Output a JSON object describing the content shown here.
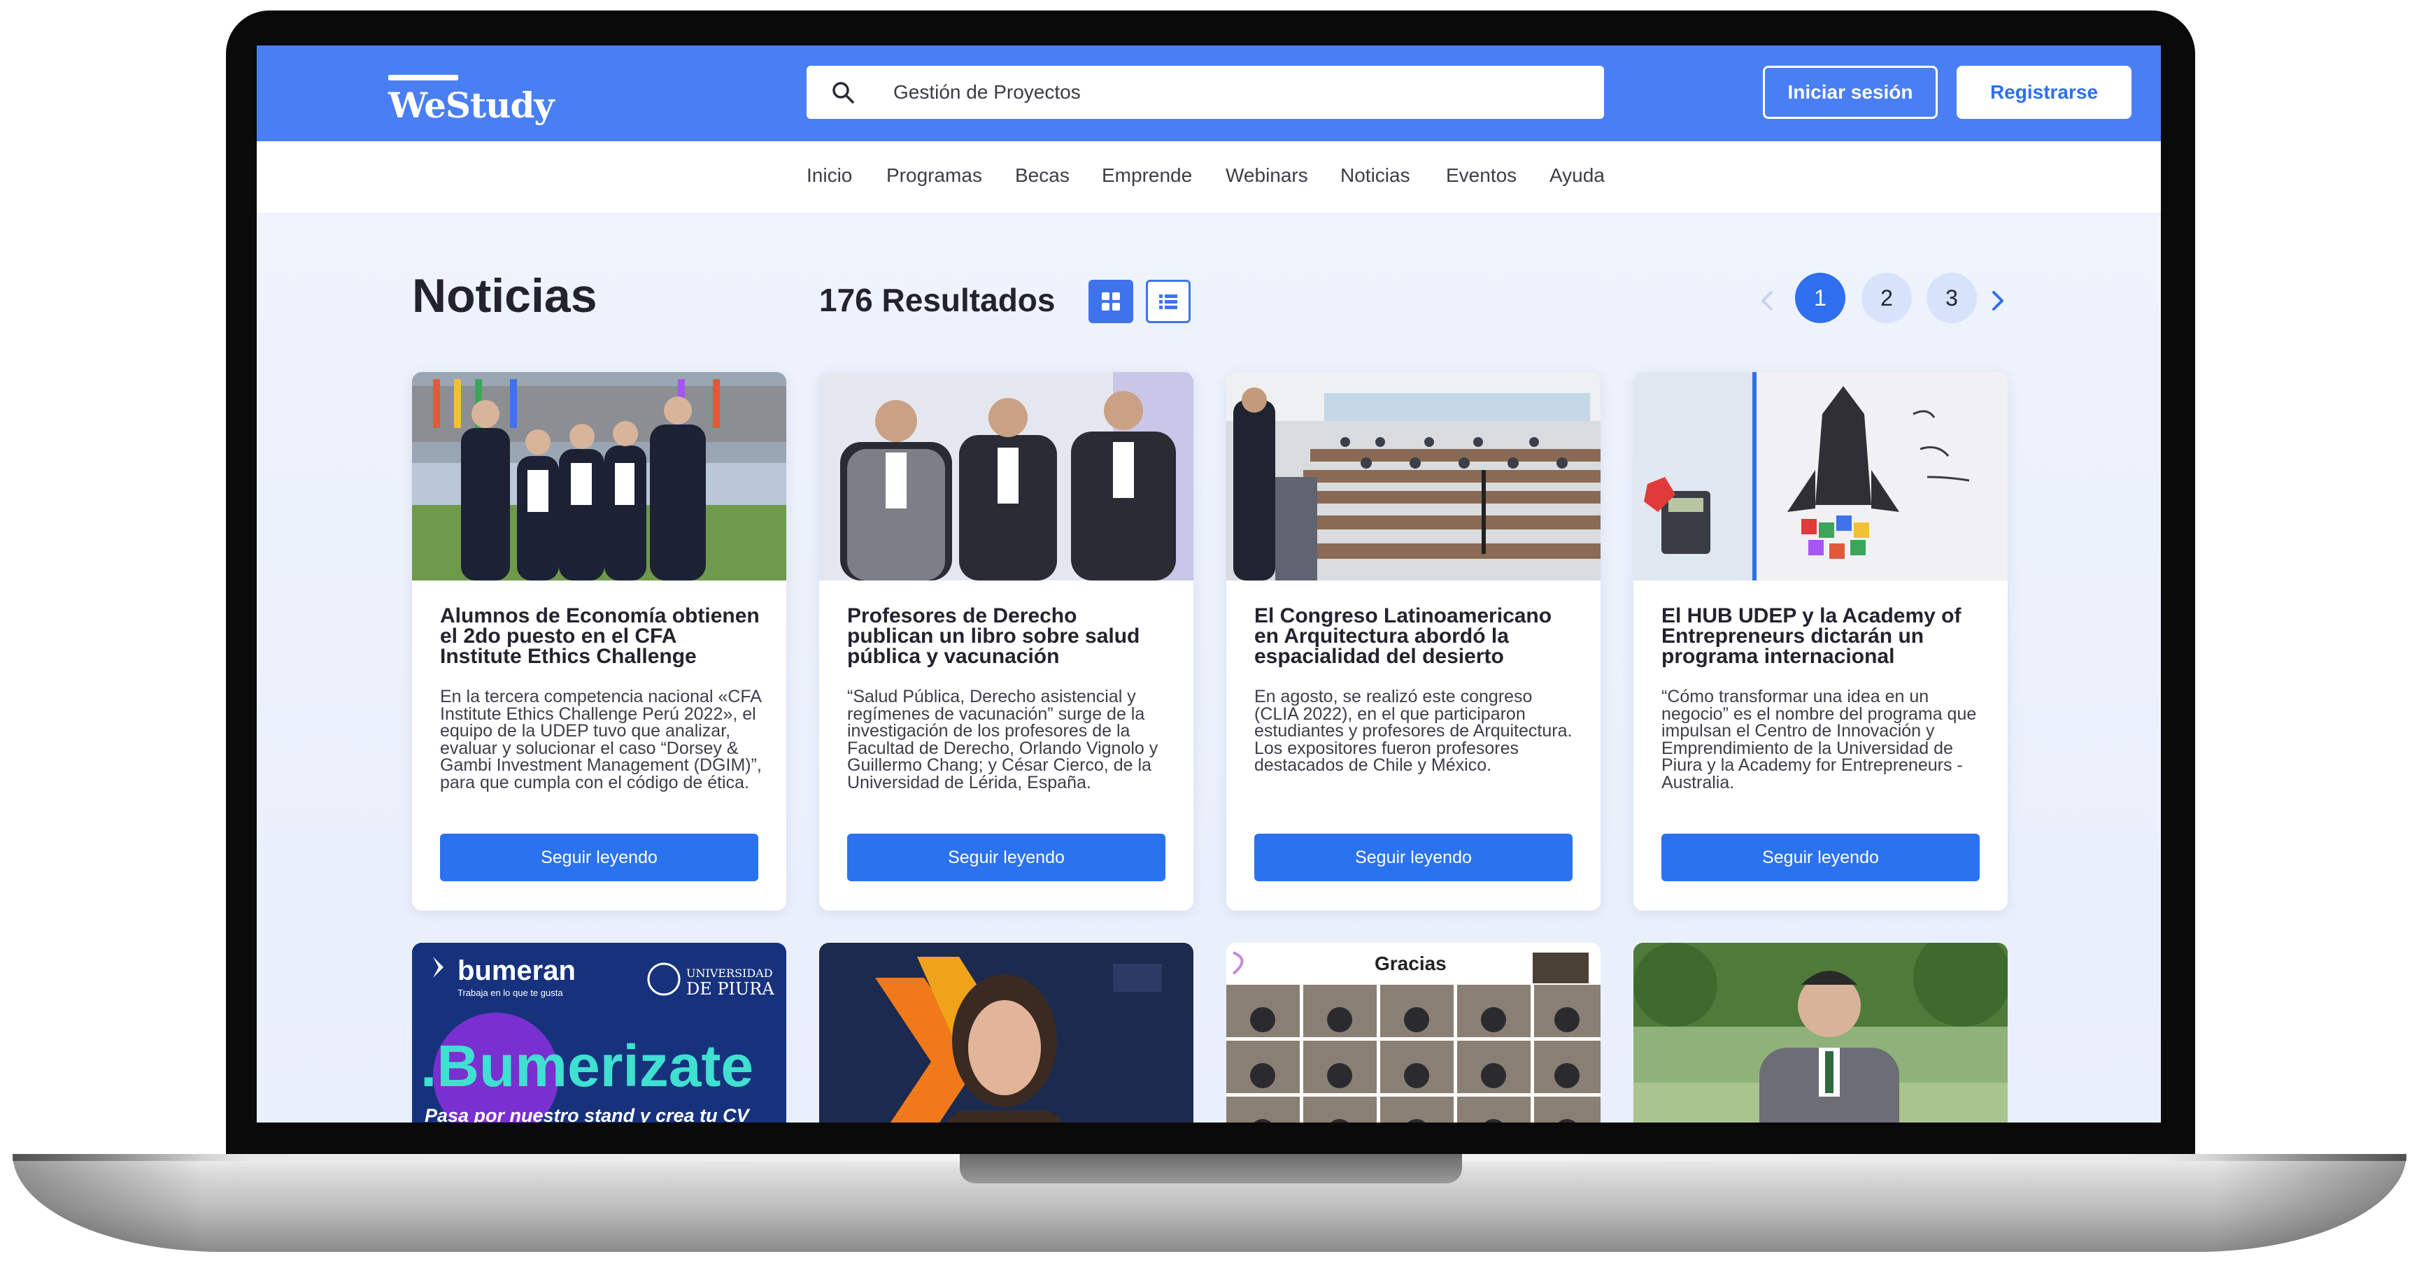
{
  "header": {
    "logo_text": "WeStudy",
    "search_value": "Gestión de Proyectos",
    "login_label": "Iniciar sesión",
    "register_label": "Registrarse"
  },
  "nav": [
    "Inicio",
    "Programas",
    "Becas",
    "Emprende",
    "Webinars",
    "Noticias",
    "Eventos",
    "Ayuda"
  ],
  "main": {
    "title": "Noticias",
    "results": "176 Resultados",
    "pages": [
      "1",
      "2",
      "3"
    ]
  },
  "cards": [
    {
      "title": "Alumnos de Economía obtienen el 2do puesto en el CFA Institute Ethics Challenge",
      "text": "En la tercera competencia nacional «CFA Institute Ethics Challenge Perú 2022», el equipo de la UDEP tuvo que analizar, evaluar y solucionar el caso “Dorsey & Gambi Investment Management (DGIM)”, para que cumpla con el código de ética.",
      "cta": "Seguir leyendo"
    },
    {
      "title": "Profesores de Derecho publican un libro sobre salud pública y vacunación",
      "text": "“Salud Pública, Derecho asistencial y regímenes de vacunación” surge de la investigación de los profesores de la Facultad de Derecho, Orlando Vignolo y Guillermo Chang; y César Cierco, de la Universidad de Lérida, España.",
      "cta": "Seguir leyendo"
    },
    {
      "title": "El Congreso Latinoamericano en Arquitectura abordó la espacialidad del desierto",
      "text": "En agosto, se realizó este congreso (CLIA 2022), en el que participaron estudiantes y profesores de Arquitectura. Los expositores fueron profesores destacados de Chile y México.",
      "cta": "Seguir leyendo"
    },
    {
      "title": "El HUB UDEP y la Academy of Entrepreneurs dictarán un programa internacional",
      "text": "“Cómo transformar una idea en un negocio” es el nombre del programa que impulsan el Centro de Innovación y Emprendimiento de la Universidad de Piura y la Academy for Entrepreneurs - Australia.",
      "cta": "Seguir leyendo"
    }
  ],
  "row2": {
    "bumeran_brand": "bumeran",
    "bumeran_tag": "Trabaja en lo que te gusta",
    "udep_small": "UNIVERSIDAD",
    "udep_big": "DE PIURA",
    "bumerizate": ".Bumerizate",
    "bumerizate_sub": "Pasa por nuestro stand y crea tu CV ideal.",
    "gracias": "Gracias"
  },
  "colors": {
    "topbar": "#4a7ff3",
    "accent": "#2f6ff0",
    "button": "#2b72ef"
  }
}
